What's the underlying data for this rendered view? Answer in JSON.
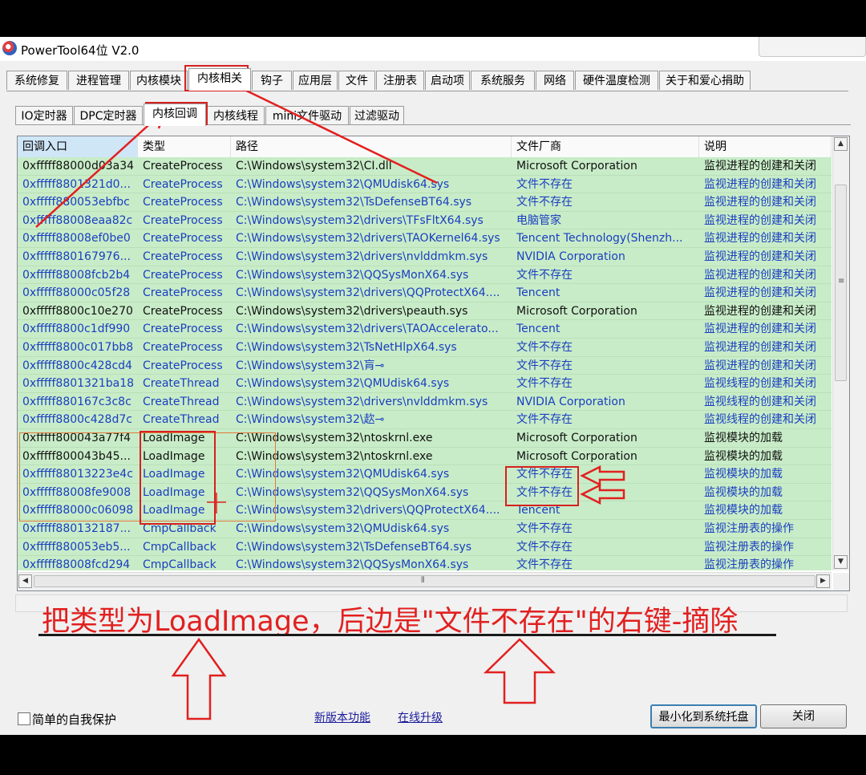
{
  "window": {
    "title": "PowerTool64位 V2.0"
  },
  "main_tabs": [
    {
      "label": "系统修复"
    },
    {
      "label": "进程管理"
    },
    {
      "label": "内核模块"
    },
    {
      "label": "内核相关"
    },
    {
      "label": "钩子"
    },
    {
      "label": "应用层"
    },
    {
      "label": "文件"
    },
    {
      "label": "注册表"
    },
    {
      "label": "启动项"
    },
    {
      "label": "系统服务"
    },
    {
      "label": "网络"
    },
    {
      "label": "硬件温度检测"
    },
    {
      "label": "关于和爱心捐助"
    }
  ],
  "main_tabs_active": "内核相关",
  "sub_tabs": [
    {
      "label": "IO定时器"
    },
    {
      "label": "DPC定时器"
    },
    {
      "label": "内核回调"
    },
    {
      "label": "内核线程"
    },
    {
      "label": "mini文件驱动"
    },
    {
      "label": "过滤驱动"
    }
  ],
  "sub_tabs_active": "内核回调",
  "table": {
    "columns": [
      "回调入口",
      "类型",
      "路径",
      "文件厂商",
      "说明"
    ],
    "rows": [
      {
        "entry": "0xfffff88000d03a34",
        "type": "CreateProcess",
        "path": "C:\\Windows\\system32\\CI.dll",
        "vendor": "Microsoft Corporation",
        "desc": "监视进程的创建和关闭",
        "color": "black"
      },
      {
        "entry": "0xfffff8801321d0...",
        "type": "CreateProcess",
        "path": "C:\\Windows\\system32\\QMUdisk64.sys",
        "vendor": "文件不存在",
        "desc": "监视进程的创建和关闭",
        "color": "blue"
      },
      {
        "entry": "0xfffff880053ebfbc",
        "type": "CreateProcess",
        "path": "C:\\Windows\\system32\\TsDefenseBT64.sys",
        "vendor": "文件不存在",
        "desc": "监视进程的创建和关闭",
        "color": "blue"
      },
      {
        "entry": "0xfffff88008eaa82c",
        "type": "CreateProcess",
        "path": "C:\\Windows\\system32\\drivers\\TFsFltX64.sys",
        "vendor": "电脑管家",
        "desc": "监视进程的创建和关闭",
        "color": "blue"
      },
      {
        "entry": "0xfffff88008ef0be0",
        "type": "CreateProcess",
        "path": "C:\\Windows\\system32\\drivers\\TAOKernel64.sys",
        "vendor": "Tencent Technology(Shenzh...",
        "desc": "监视进程的创建和关闭",
        "color": "blue"
      },
      {
        "entry": "0xfffff880167976...",
        "type": "CreateProcess",
        "path": "C:\\Windows\\system32\\drivers\\nvlddmkm.sys",
        "vendor": "NVIDIA Corporation",
        "desc": "监视进程的创建和关闭",
        "color": "blue"
      },
      {
        "entry": "0xfffff88008fcb2b4",
        "type": "CreateProcess",
        "path": "C:\\Windows\\system32\\QQSysMonX64.sys",
        "vendor": "文件不存在",
        "desc": "监视进程的创建和关闭",
        "color": "blue"
      },
      {
        "entry": "0xfffff88000c05f28",
        "type": "CreateProcess",
        "path": "C:\\Windows\\system32\\drivers\\QQProtectX64....",
        "vendor": "Tencent",
        "desc": "监视进程的创建和关闭",
        "color": "blue"
      },
      {
        "entry": "0xfffff8800c10e270",
        "type": "CreateProcess",
        "path": "C:\\Windows\\system32\\drivers\\peauth.sys",
        "vendor": "Microsoft Corporation",
        "desc": "监视进程的创建和关闭",
        "color": "black"
      },
      {
        "entry": "0xfffff8800c1df990",
        "type": "CreateProcess",
        "path": "C:\\Windows\\system32\\drivers\\TAOAccelerato...",
        "vendor": "Tencent",
        "desc": "监视进程的创建和关闭",
        "color": "blue"
      },
      {
        "entry": "0xfffff8800c017bb8",
        "type": "CreateProcess",
        "path": "C:\\Windows\\system32\\TsNetHlpX64.sys",
        "vendor": "文件不存在",
        "desc": "监视进程的创建和关闭",
        "color": "blue"
      },
      {
        "entry": "0xfffff8800c428cd4",
        "type": "CreateProcess",
        "path": "C:\\Windows\\system32\\肓⊸",
        "vendor": "文件不存在",
        "desc": "监视进程的创建和关闭",
        "color": "blue"
      },
      {
        "entry": "0xfffff8801321ba18",
        "type": "CreateThread",
        "path": "C:\\Windows\\system32\\QMUdisk64.sys",
        "vendor": "文件不存在",
        "desc": "监视线程的创建和关闭",
        "color": "blue"
      },
      {
        "entry": "0xfffff880167c3c8c",
        "type": "CreateThread",
        "path": "C:\\Windows\\system32\\drivers\\nvlddmkm.sys",
        "vendor": "NVIDIA Corporation",
        "desc": "监视线程的创建和关闭",
        "color": "blue"
      },
      {
        "entry": "0xfffff8800c428d7c",
        "type": "CreateThread",
        "path": "C:\\Windows\\system32\\赼⊸",
        "vendor": "文件不存在",
        "desc": "监视线程的创建和关闭",
        "color": "blue"
      },
      {
        "entry": "0xfffff800043a77f4",
        "type": "LoadImage",
        "path": "C:\\Windows\\system32\\ntoskrnl.exe",
        "vendor": "Microsoft Corporation",
        "desc": "监视模块的加载",
        "color": "black"
      },
      {
        "entry": "0xfffff800043b45...",
        "type": "LoadImage",
        "path": "C:\\Windows\\system32\\ntoskrnl.exe",
        "vendor": "Microsoft Corporation",
        "desc": "监视模块的加载",
        "color": "black"
      },
      {
        "entry": "0xfffff88013223e4c",
        "type": "LoadImage",
        "path": "C:\\Windows\\system32\\QMUdisk64.sys",
        "vendor": "文件不存在",
        "desc": "监视模块的加载",
        "color": "blue"
      },
      {
        "entry": "0xfffff88008fe9008",
        "type": "LoadImage",
        "path": "C:\\Windows\\system32\\QQSysMonX64.sys",
        "vendor": "文件不存在",
        "desc": "监视模块的加载",
        "color": "blue"
      },
      {
        "entry": "0xfffff88000c06098",
        "type": "LoadImage",
        "path": "C:\\Windows\\system32\\drivers\\QQProtectX64....",
        "vendor": "Tencent",
        "desc": "监视模块的加载",
        "color": "blue"
      },
      {
        "entry": "0xfffff880132187...",
        "type": "CmpCallback",
        "path": "C:\\Windows\\system32\\QMUdisk64.sys",
        "vendor": "文件不存在",
        "desc": "监视注册表的操作",
        "color": "blue"
      },
      {
        "entry": "0xfffff880053eb5...",
        "type": "CmpCallback",
        "path": "C:\\Windows\\system32\\TsDefenseBT64.sys",
        "vendor": "文件不存在",
        "desc": "监视注册表的操作",
        "color": "blue"
      },
      {
        "entry": "0xfffff88008fcd294",
        "type": "CmpCallback",
        "path": "C:\\Windows\\system32\\QQSysMonX64.sys",
        "vendor": "文件不存在",
        "desc": "监视注册表的操作",
        "color": "blue"
      }
    ]
  },
  "annotation": {
    "text": "把类型为LoadImage，后边是\"文件不存在\"的右键-摘除"
  },
  "footer": {
    "self_protect_label": "简单的自我保护",
    "new_features_link": "新版本功能",
    "online_upgrade_link": "在线升级",
    "minimize_button": "最小化到系统托盘",
    "close_button": "关闭"
  },
  "colors": {
    "row_bg": "#c8ecc8",
    "blue_text": "#1a3ec0",
    "annotation_red": "#e22020"
  }
}
